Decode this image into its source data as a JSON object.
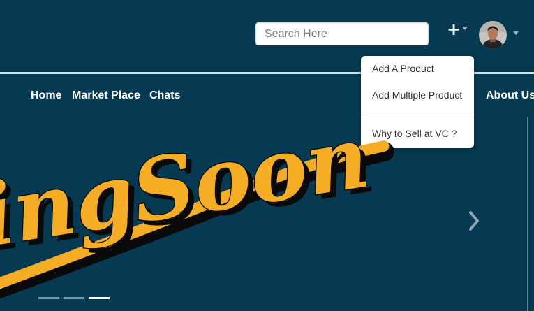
{
  "header": {
    "search": {
      "placeholder": "Search Here",
      "value": ""
    },
    "add_button_icon": "plus-icon",
    "user_menu_icon": "avatar"
  },
  "nav": {
    "items": [
      {
        "label": "Home"
      },
      {
        "label": "Market Place"
      },
      {
        "label": "Chats"
      },
      {
        "label": "About Us"
      }
    ]
  },
  "add_menu": {
    "items": [
      {
        "label": "Add A Product"
      },
      {
        "label": "Add Multiple Product"
      },
      {
        "label": "Why to Sell at VC ?"
      }
    ]
  },
  "hero": {
    "banner_text": "ingSoon",
    "carousel": {
      "slide_count": 3,
      "active_index": 2,
      "next_icon": "chevron-right-icon"
    }
  },
  "colors": {
    "background": "#053a52",
    "banner_yellow": "#f5ad25",
    "banner_shadow": "#0a0a0a",
    "text_light": "#ffffff"
  }
}
